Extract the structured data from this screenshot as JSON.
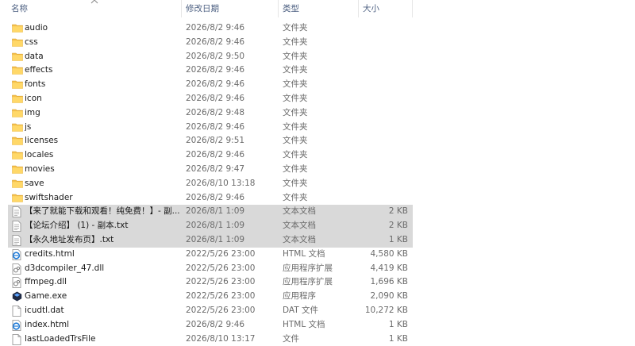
{
  "columns": {
    "name": "名称",
    "date": "修改日期",
    "type": "类型",
    "size": "大小"
  },
  "files": [
    {
      "icon": "folder-icon",
      "name": "audio",
      "date": "2026/8/2 9:46",
      "type": "文件夹",
      "size": ""
    },
    {
      "icon": "folder-icon",
      "name": "css",
      "date": "2026/8/2 9:46",
      "type": "文件夹",
      "size": ""
    },
    {
      "icon": "folder-icon",
      "name": "data",
      "date": "2026/8/2 9:50",
      "type": "文件夹",
      "size": ""
    },
    {
      "icon": "folder-icon",
      "name": "effects",
      "date": "2026/8/2 9:46",
      "type": "文件夹",
      "size": ""
    },
    {
      "icon": "folder-icon",
      "name": "fonts",
      "date": "2026/8/2 9:46",
      "type": "文件夹",
      "size": ""
    },
    {
      "icon": "folder-icon",
      "name": "icon",
      "date": "2026/8/2 9:46",
      "type": "文件夹",
      "size": ""
    },
    {
      "icon": "folder-icon",
      "name": "img",
      "date": "2026/8/2 9:48",
      "type": "文件夹",
      "size": ""
    },
    {
      "icon": "folder-icon",
      "name": "js",
      "date": "2026/8/2 9:46",
      "type": "文件夹",
      "size": ""
    },
    {
      "icon": "folder-icon",
      "name": "licenses",
      "date": "2026/8/2 9:51",
      "type": "文件夹",
      "size": ""
    },
    {
      "icon": "folder-icon",
      "name": "locales",
      "date": "2026/8/2 9:46",
      "type": "文件夹",
      "size": ""
    },
    {
      "icon": "folder-icon",
      "name": "movies",
      "date": "2026/8/2 9:47",
      "type": "文件夹",
      "size": ""
    },
    {
      "icon": "folder-icon",
      "name": "save",
      "date": "2026/8/10 13:18",
      "type": "文件夹",
      "size": ""
    },
    {
      "icon": "folder-icon",
      "name": "swiftshader",
      "date": "2026/8/2 9:46",
      "type": "文件夹",
      "size": ""
    },
    {
      "icon": "text-file-icon",
      "name": "【来了就能下载和观看！纯免费！】- 副...",
      "date": "2026/8/1 1:09",
      "type": "文本文档",
      "size": "2 KB",
      "selected": true
    },
    {
      "icon": "text-file-icon",
      "name": "【论坛介绍】 (1) - 副本.txt",
      "date": "2026/8/1 1:09",
      "type": "文本文档",
      "size": "2 KB",
      "selected": true
    },
    {
      "icon": "text-file-icon",
      "name": "【永久地址发布页】.txt",
      "date": "2026/8/1 1:09",
      "type": "文本文档",
      "size": "1 KB",
      "selected": true
    },
    {
      "icon": "html-file-icon",
      "name": "credits.html",
      "date": "2022/5/26 23:00",
      "type": "HTML 文档",
      "size": "4,580 KB"
    },
    {
      "icon": "dll-file-icon",
      "name": "d3dcompiler_47.dll",
      "date": "2022/5/26 23:00",
      "type": "应用程序扩展",
      "size": "4,419 KB"
    },
    {
      "icon": "dll-file-icon",
      "name": "ffmpeg.dll",
      "date": "2022/5/26 23:00",
      "type": "应用程序扩展",
      "size": "1,696 KB"
    },
    {
      "icon": "exe-app-icon",
      "name": "Game.exe",
      "date": "2022/5/26 23:00",
      "type": "应用程序",
      "size": "2,090 KB"
    },
    {
      "icon": "blank-file-icon",
      "name": "icudtl.dat",
      "date": "2022/5/26 23:00",
      "type": "DAT 文件",
      "size": "10,272 KB"
    },
    {
      "icon": "html-file-icon",
      "name": "index.html",
      "date": "2026/8/2 9:46",
      "type": "HTML 文档",
      "size": "1 KB"
    },
    {
      "icon": "blank-file-icon",
      "name": "lastLoadedTrsFile",
      "date": "2026/8/10 13:17",
      "type": "文件",
      "size": "1 KB"
    }
  ]
}
